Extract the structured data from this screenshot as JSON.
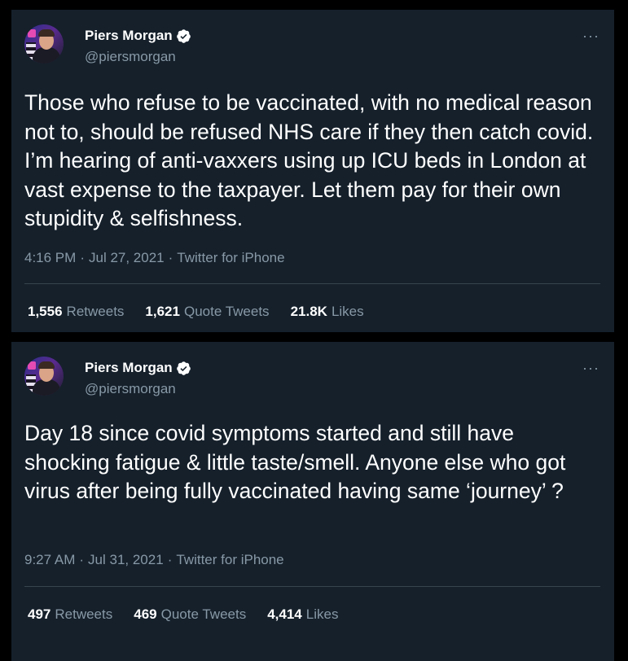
{
  "colors": {
    "background": "#15202b",
    "text_primary": "#ffffff",
    "text_secondary": "#8899a6",
    "divider": "#38444d",
    "verified_badge": "#ffffff"
  },
  "icons": {
    "verified": "verified-badge-icon",
    "more": "more-options-icon"
  },
  "tweets": [
    {
      "author_name": "Piers Morgan",
      "handle": "@piersmorgan",
      "more": "···",
      "text": "Those who refuse to be vaccinated, with no medical reason not to, should be refused NHS care if they then catch covid. I’m hearing of anti-vaxxers using up ICU beds in London at vast expense to the taxpayer. Let them pay for their own stupidity & selfishness.",
      "time": "4:16 PM",
      "sep1": "·",
      "date": "Jul 27, 2021",
      "sep2": "·",
      "source": "Twitter for iPhone",
      "retweets_count": "1,556",
      "retweets_label": "Retweets",
      "quotes_count": "1,621",
      "quotes_label": "Quote Tweets",
      "likes_count": "21.8K",
      "likes_label": "Likes"
    },
    {
      "author_name": "Piers Morgan",
      "handle": "@piersmorgan",
      "more": "···",
      "text": "Day 18 since covid symptoms started and still have shocking fatigue & little taste/smell. Anyone else who got virus after being fully vaccinated having same ‘journey’ ?",
      "time": "9:27 AM",
      "sep1": "·",
      "date": "Jul 31, 2021",
      "sep2": "·",
      "source": "Twitter for iPhone",
      "retweets_count": "497",
      "retweets_label": "Retweets",
      "quotes_count": "469",
      "quotes_label": "Quote Tweets",
      "likes_count": "4,414",
      "likes_label": "Likes"
    }
  ]
}
